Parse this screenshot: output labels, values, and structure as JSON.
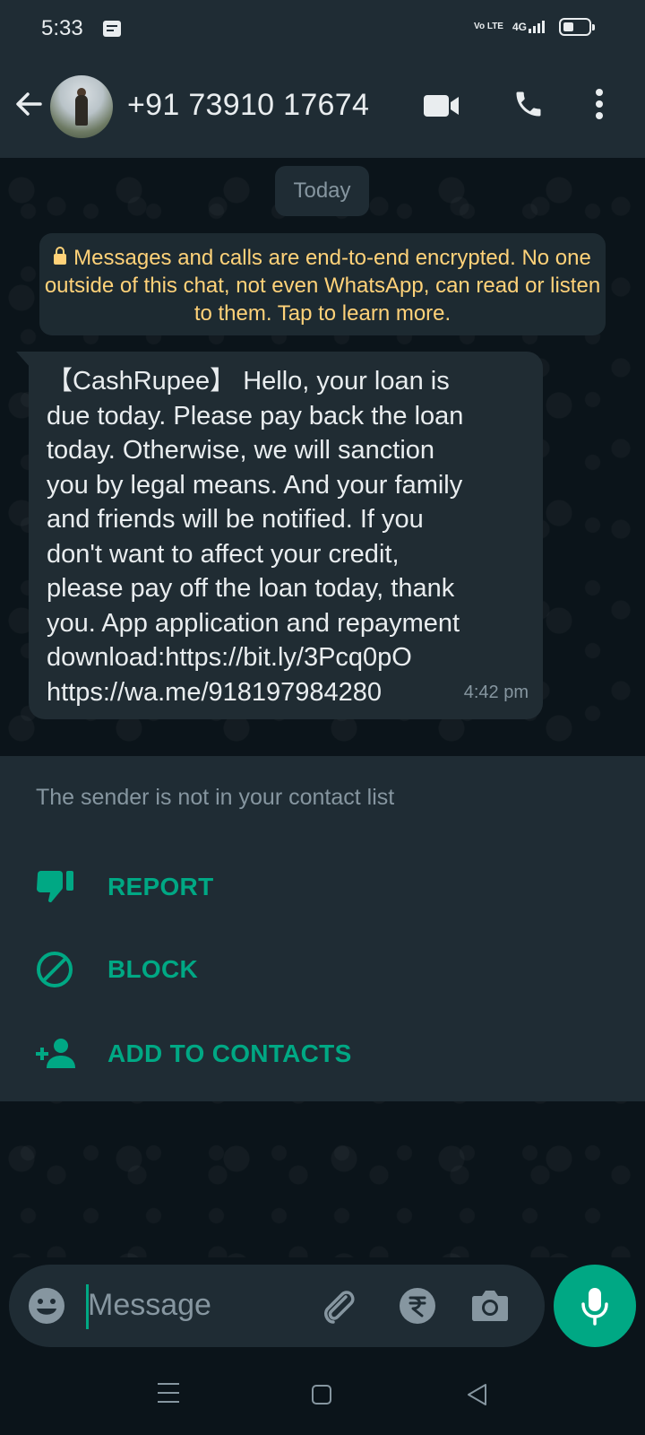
{
  "status_bar": {
    "time": "5:33",
    "volte": "Vo LTE",
    "network": "4G"
  },
  "header": {
    "contact_name": "+91 73910 17674"
  },
  "chat": {
    "date_chip": "Today",
    "encryption_notice": "Messages and calls are end-to-end encrypted. No one outside of this chat, not even WhatsApp, can read or listen to them. Tap to learn more.",
    "messages": [
      {
        "text": "【CashRupee】 Hello, your loan is\ndue today. Please pay back the loan\ntoday. Otherwise, we will sanction\nyou by legal means. And your family\nand friends will be notified. If you\ndon't want to affect your credit,\nplease pay off the loan today, thank\nyou. App application and repayment\ndownload:https://bit.ly/3Pcq0pO\nhttps://wa.me/918197984280",
        "time": "4:42 pm"
      }
    ]
  },
  "unknown_sender": {
    "title": "The sender is not in your contact list",
    "actions": [
      {
        "label": "REPORT",
        "icon": "thumbs-down-icon"
      },
      {
        "label": "BLOCK",
        "icon": "block-icon"
      },
      {
        "label": "ADD TO CONTACTS",
        "icon": "add-person-icon"
      }
    ]
  },
  "input": {
    "placeholder": "Message"
  },
  "colors": {
    "accent": "#00a884",
    "header_bg": "#1f2c34",
    "chat_bg": "#0b141a",
    "bubble_bg": "#202c33",
    "notice_text": "#ffd279"
  }
}
